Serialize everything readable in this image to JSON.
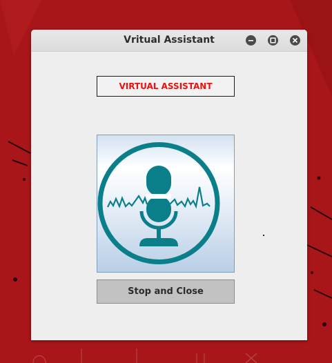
{
  "window": {
    "title": "Vritual Assistant"
  },
  "main": {
    "heading": "VIRTUAL ASSISTANT",
    "stop_button_label": "Stop and Close"
  },
  "icons": {
    "minimize": "minimize-icon",
    "maximize": "maximize-icon",
    "close": "close-icon",
    "microphone": "microphone-icon"
  },
  "colors": {
    "desktop_background": "#a8161a",
    "heading_text": "#e8110f",
    "microphone": "#0a7f8a",
    "window_background": "#eeeeee"
  }
}
